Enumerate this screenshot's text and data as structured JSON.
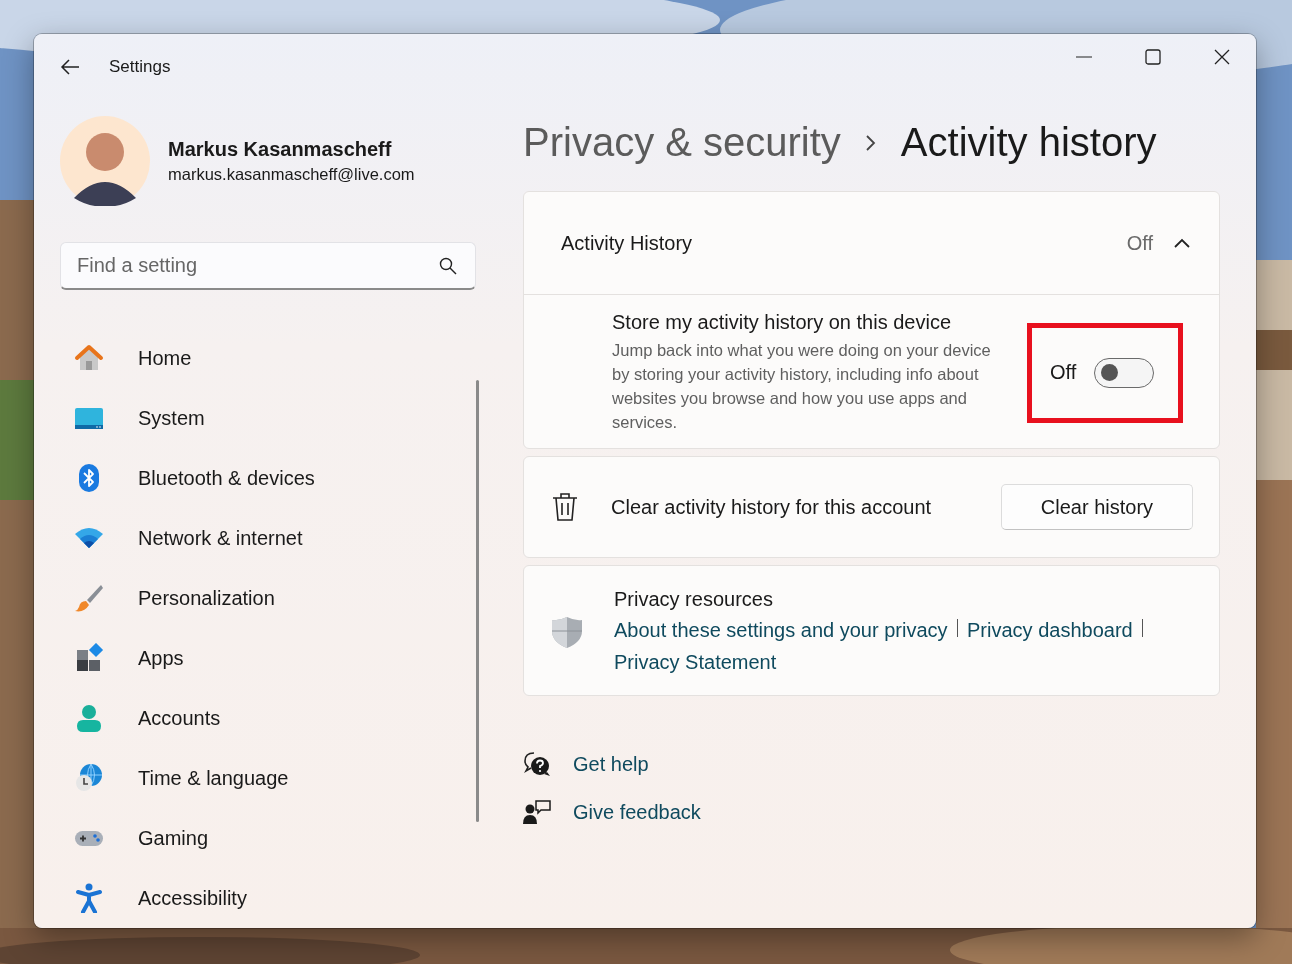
{
  "window": {
    "title": "Settings"
  },
  "profile": {
    "name": "Markus Kasanmascheff",
    "email": "markus.kasanmascheff@live.com"
  },
  "search": {
    "placeholder": "Find a setting"
  },
  "nav": [
    {
      "label": "Home"
    },
    {
      "label": "System"
    },
    {
      "label": "Bluetooth & devices"
    },
    {
      "label": "Network & internet"
    },
    {
      "label": "Personalization"
    },
    {
      "label": "Apps"
    },
    {
      "label": "Accounts"
    },
    {
      "label": "Time & language"
    },
    {
      "label": "Gaming"
    },
    {
      "label": "Accessibility"
    }
  ],
  "breadcrumb": {
    "parent": "Privacy & security",
    "current": "Activity history"
  },
  "activity_history": {
    "title": "Activity History",
    "status": "Off",
    "expanded": true,
    "setting": {
      "title": "Store my activity history on this device",
      "description": "Jump back into what you were doing on your device by storing your activity history, including info about websites you browse and how you use apps and services.",
      "toggle": {
        "label": "Off",
        "on": false,
        "highlighted": true
      }
    }
  },
  "clear": {
    "label": "Clear activity history for this account",
    "button": "Clear history"
  },
  "resources": {
    "title": "Privacy resources",
    "links": [
      "About these settings and your privacy",
      "Privacy dashboard",
      "Privacy Statement"
    ]
  },
  "help_links": [
    {
      "label": "Get help"
    },
    {
      "label": "Give feedback"
    }
  ]
}
